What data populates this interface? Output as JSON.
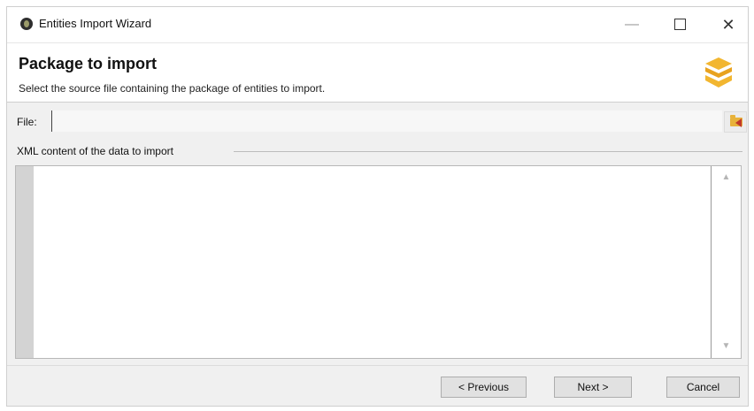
{
  "window": {
    "title": "Entities Import Wizard",
    "controls": {
      "minimize": "—",
      "close": "✕"
    }
  },
  "header": {
    "title": "Package to import",
    "subtitle": "Select the source file containing the package of entities to import.",
    "icon": "package-icon"
  },
  "file": {
    "label": "File:",
    "value": "",
    "browse_icon": "folder-icon"
  },
  "xml": {
    "group_label": "XML content of the data to import",
    "content": "",
    "scroll_up": "▲",
    "scroll_down": "▼"
  },
  "buttons": {
    "previous": "< Previous",
    "next": "Next >",
    "cancel": "Cancel"
  },
  "colors": {
    "accent": "#e8b23a",
    "arrow": "#c0392b"
  }
}
